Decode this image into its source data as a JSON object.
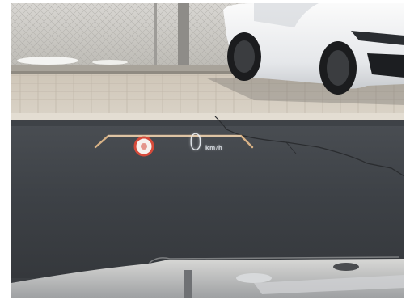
{
  "scene": {
    "hud": {
      "speed_value": "0",
      "speed_unit": "km/h",
      "extra_indicator": "",
      "speed_limit_sign": ""
    }
  }
}
